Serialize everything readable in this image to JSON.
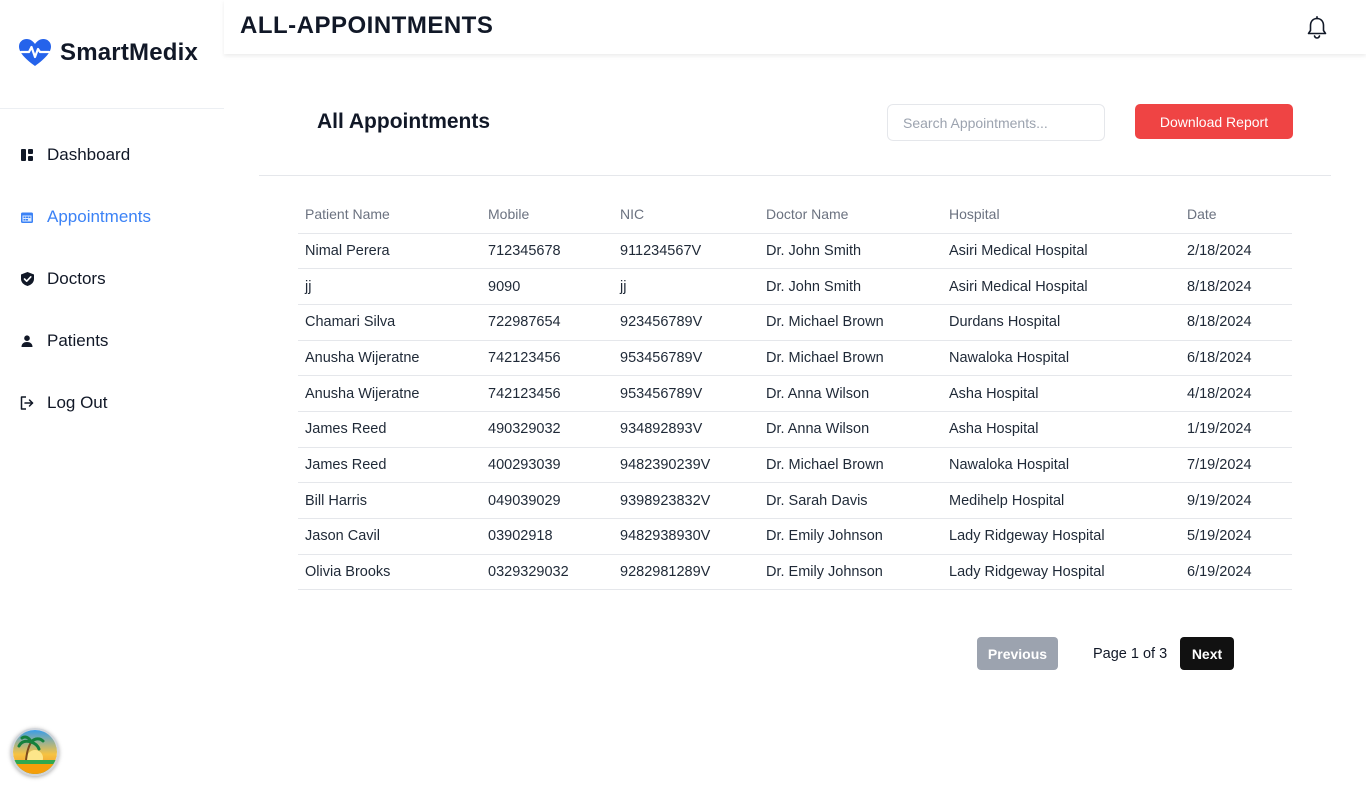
{
  "app": {
    "name": "SmartMedix",
    "brand_color": "#2563eb",
    "logo_icon": "heart-pulse-icon"
  },
  "sidebar": {
    "items": [
      {
        "label": "Dashboard",
        "icon": "dashboard-icon",
        "active": false
      },
      {
        "label": "Appointments",
        "icon": "calendar-icon",
        "active": true
      },
      {
        "label": "Doctors",
        "icon": "shield-check-icon",
        "active": false
      },
      {
        "label": "Patients",
        "icon": "user-icon",
        "active": false
      },
      {
        "label": "Log Out",
        "icon": "logout-icon",
        "active": false
      }
    ],
    "active_color": "#3b82f6"
  },
  "header": {
    "title": "ALL-APPOINTMENTS",
    "notification_icon": "bell-icon"
  },
  "main": {
    "section_title": "All Appointments",
    "search": {
      "placeholder": "Search Appointments...",
      "value": ""
    },
    "download_label": "Download Report",
    "download_color": "#ef4444",
    "table": {
      "columns": [
        "Patient Name",
        "Mobile",
        "NIC",
        "Doctor Name",
        "Hospital",
        "Date"
      ],
      "rows": [
        [
          "Nimal Perera",
          "712345678",
          "911234567V",
          "Dr. John Smith",
          "Asiri Medical Hospital",
          "2/18/2024"
        ],
        [
          "jj",
          "9090",
          "jj",
          "Dr. John Smith",
          "Asiri Medical Hospital",
          "8/18/2024"
        ],
        [
          "Chamari Silva",
          "722987654",
          "923456789V",
          "Dr. Michael Brown",
          "Durdans Hospital",
          "8/18/2024"
        ],
        [
          "Anusha Wijeratne",
          "742123456",
          "953456789V",
          "Dr. Michael Brown",
          "Nawaloka Hospital",
          "6/18/2024"
        ],
        [
          "Anusha Wijeratne",
          "742123456",
          "953456789V",
          "Dr. Anna Wilson",
          "Asha Hospital",
          "4/18/2024"
        ],
        [
          "James Reed",
          "490329032",
          "934892893V",
          "Dr. Anna Wilson",
          "Asha Hospital",
          "1/19/2024"
        ],
        [
          "James Reed",
          "400293039",
          "9482390239V",
          "Dr. Michael Brown",
          "Nawaloka Hospital",
          "7/19/2024"
        ],
        [
          "Bill Harris",
          "049039029",
          "9398923832V",
          "Dr. Sarah Davis",
          "Medihelp Hospital",
          "9/19/2024"
        ],
        [
          "Jason Cavil",
          "03902918",
          "9482938930V",
          "Dr. Emily Johnson",
          "Lady Ridgeway Hospital",
          "5/19/2024"
        ],
        [
          "Olivia Brooks",
          "0329329032",
          "9282981289V",
          "Dr. Emily Johnson",
          "Lady Ridgeway Hospital",
          "6/19/2024"
        ]
      ]
    },
    "pagination": {
      "previous_label": "Previous",
      "page_info": "Page 1 of 3",
      "next_label": "Next"
    }
  },
  "floating_avatar": {
    "icon": "beach-sunset-avatar-icon"
  }
}
